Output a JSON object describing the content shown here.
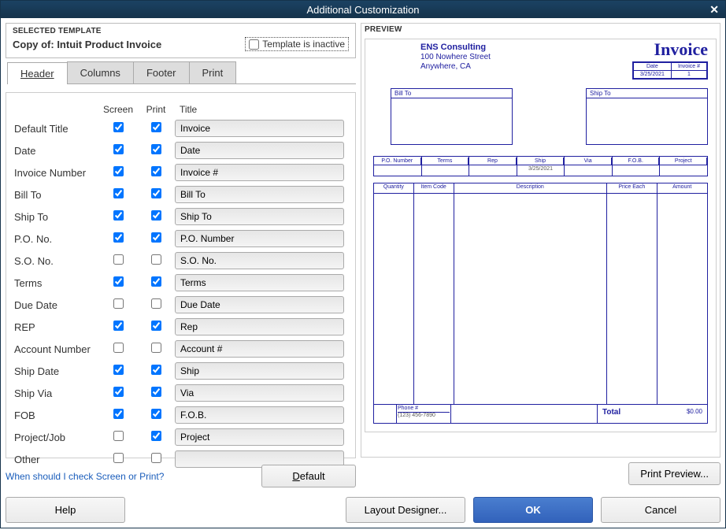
{
  "window": {
    "title": "Additional Customization"
  },
  "selected_template": {
    "label": "SELECTED TEMPLATE",
    "name": "Copy of: Intuit Product Invoice",
    "inactive_label": "Template is inactive",
    "inactive_checked": false
  },
  "tabs": [
    {
      "label": "Header",
      "active": true
    },
    {
      "label": "Columns",
      "active": false
    },
    {
      "label": "Footer",
      "active": false
    },
    {
      "label": "Print",
      "active": false
    }
  ],
  "field_headers": {
    "screen": "Screen",
    "print": "Print",
    "title": "Title"
  },
  "fields": [
    {
      "label": "Default Title",
      "screen": true,
      "print": true,
      "title": "Invoice"
    },
    {
      "label": "Date",
      "screen": true,
      "print": true,
      "title": "Date"
    },
    {
      "label": "Invoice Number",
      "screen": true,
      "print": true,
      "title": "Invoice #"
    },
    {
      "label": "Bill To",
      "screen": true,
      "print": true,
      "title": "Bill To"
    },
    {
      "label": "Ship To",
      "screen": true,
      "print": true,
      "title": "Ship To"
    },
    {
      "label": "P.O. No.",
      "screen": true,
      "print": true,
      "title": "P.O. Number"
    },
    {
      "label": "S.O. No.",
      "screen": false,
      "print": false,
      "title": "S.O. No."
    },
    {
      "label": "Terms",
      "screen": true,
      "print": true,
      "title": "Terms"
    },
    {
      "label": "Due Date",
      "screen": false,
      "print": false,
      "title": "Due Date"
    },
    {
      "label": "REP",
      "screen": true,
      "print": true,
      "title": "Rep"
    },
    {
      "label": "Account Number",
      "screen": false,
      "print": false,
      "title": "Account #"
    },
    {
      "label": "Ship Date",
      "screen": true,
      "print": true,
      "title": "Ship"
    },
    {
      "label": "Ship Via",
      "screen": true,
      "print": true,
      "title": "Via"
    },
    {
      "label": "FOB",
      "screen": true,
      "print": true,
      "title": "F.O.B."
    },
    {
      "label": "Project/Job",
      "screen": false,
      "print": true,
      "title": "Project"
    },
    {
      "label": "Other",
      "screen": false,
      "print": false,
      "title": ""
    }
  ],
  "link_text": "When should I check Screen or Print?",
  "buttons": {
    "default": "Default",
    "print_preview": "Print Preview...",
    "help": "Help",
    "layout_designer": "Layout Designer...",
    "ok": "OK",
    "cancel": "Cancel"
  },
  "preview": {
    "label": "PREVIEW",
    "company": "ENS Consulting",
    "addr1": "100 Nowhere Street",
    "addr2": "Anywhere, CA",
    "title": "Invoice",
    "date_h": "Date",
    "inv_h": "Invoice #",
    "date": "3/25/2021",
    "invnum": "1",
    "billto": "Bill To",
    "shipto": "Ship To",
    "cols": [
      "P.O. Number",
      "Terms",
      "Rep",
      "Ship",
      "Via",
      "F.O.B.",
      "Project"
    ],
    "shipval": "3/25/2021",
    "item_cols": [
      "Quantity",
      "Item Code",
      "Description",
      "Price Each",
      "Amount"
    ],
    "phone_h": "Phone #",
    "phone": "(123) 456-7890",
    "total_label": "Total",
    "total_val": "$0.00"
  }
}
